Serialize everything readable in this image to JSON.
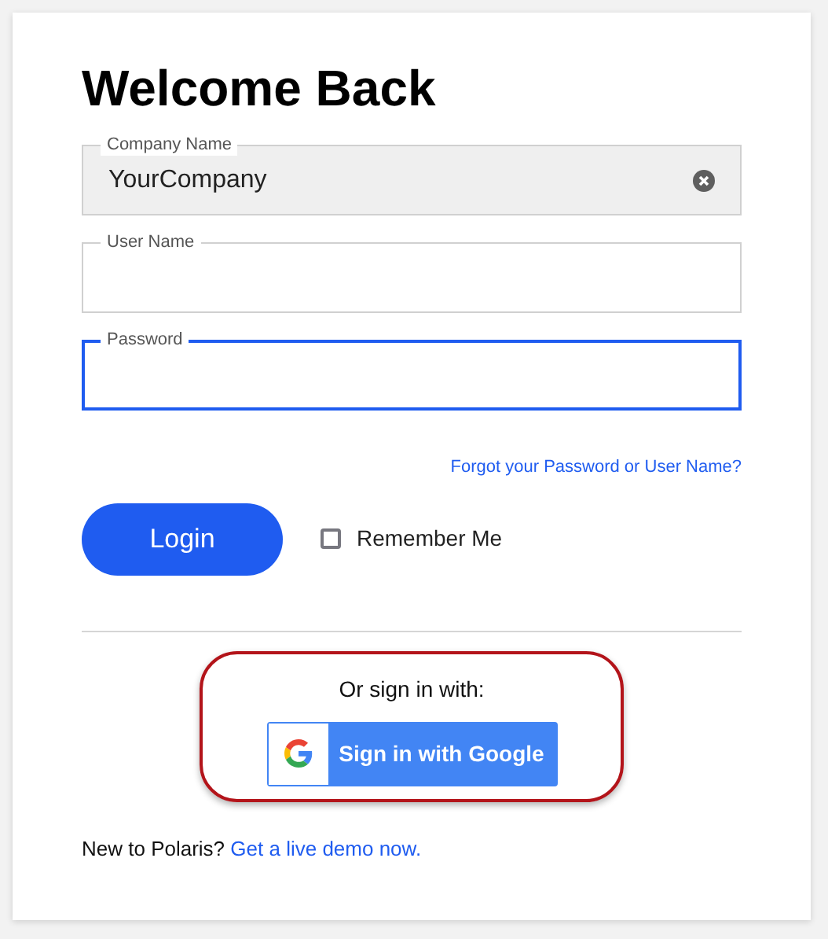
{
  "title": "Welcome Back",
  "fields": [
    {
      "label": "Company Name",
      "value": "YourCompany",
      "autofilled": true,
      "clear_button": true,
      "focused": false
    },
    {
      "label": "User Name",
      "autofilled": false,
      "clear_button": false,
      "focused": false
    },
    {
      "label": "Password",
      "autofilled": false,
      "clear_button": false,
      "focused": true
    }
  ],
  "forgot_link": "Forgot your Password or User Name?",
  "login_button": "Login",
  "remember_me": {
    "label": "Remember Me",
    "checked": false
  },
  "social": {
    "caption": "Or sign in with:",
    "button": "Sign in with Google",
    "highlighted": true
  },
  "footer": {
    "text": "New to Polaris?",
    "link": "Get a live demo now."
  }
}
